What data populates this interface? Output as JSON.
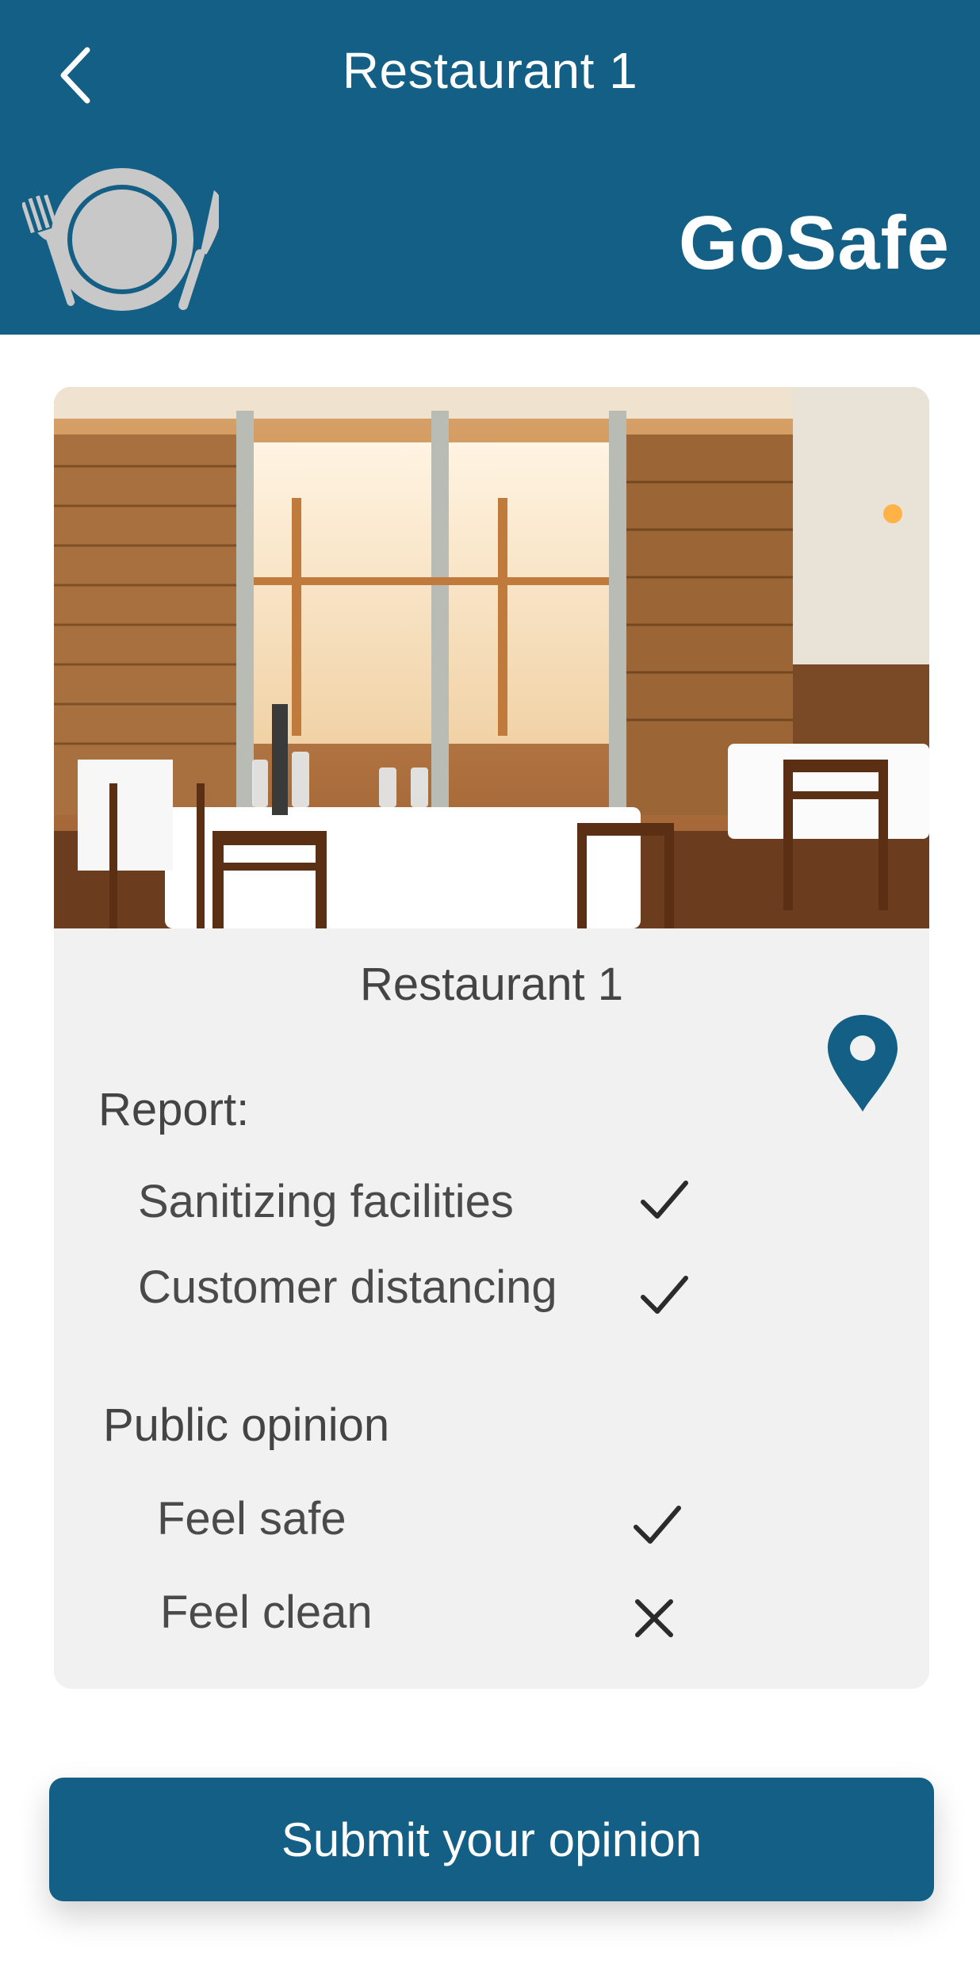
{
  "header": {
    "title": "Restaurant 1",
    "brand": "GoSafe",
    "back_icon": "chevron-left-icon",
    "logo_icon": "plate-fork-knife-icon"
  },
  "card": {
    "image_alt": "Restaurant dining room with set tables",
    "title": "Restaurant 1",
    "location_icon": "map-pin-icon",
    "report": {
      "label": "Report:",
      "items": [
        {
          "label": "Sanitizing facilities",
          "status": "check"
        },
        {
          "label": "Customer distancing",
          "status": "check"
        }
      ]
    },
    "opinion": {
      "label": "Public opinion",
      "items": [
        {
          "label": "Feel safe",
          "status": "check"
        },
        {
          "label": "Feel clean",
          "status": "cross"
        }
      ]
    }
  },
  "submit_label": "Submit your opinion",
  "colors": {
    "primary": "#135f85",
    "card_bg": "#f1f1f1",
    "text": "#444444",
    "logo_gray": "#c8c8c8"
  }
}
